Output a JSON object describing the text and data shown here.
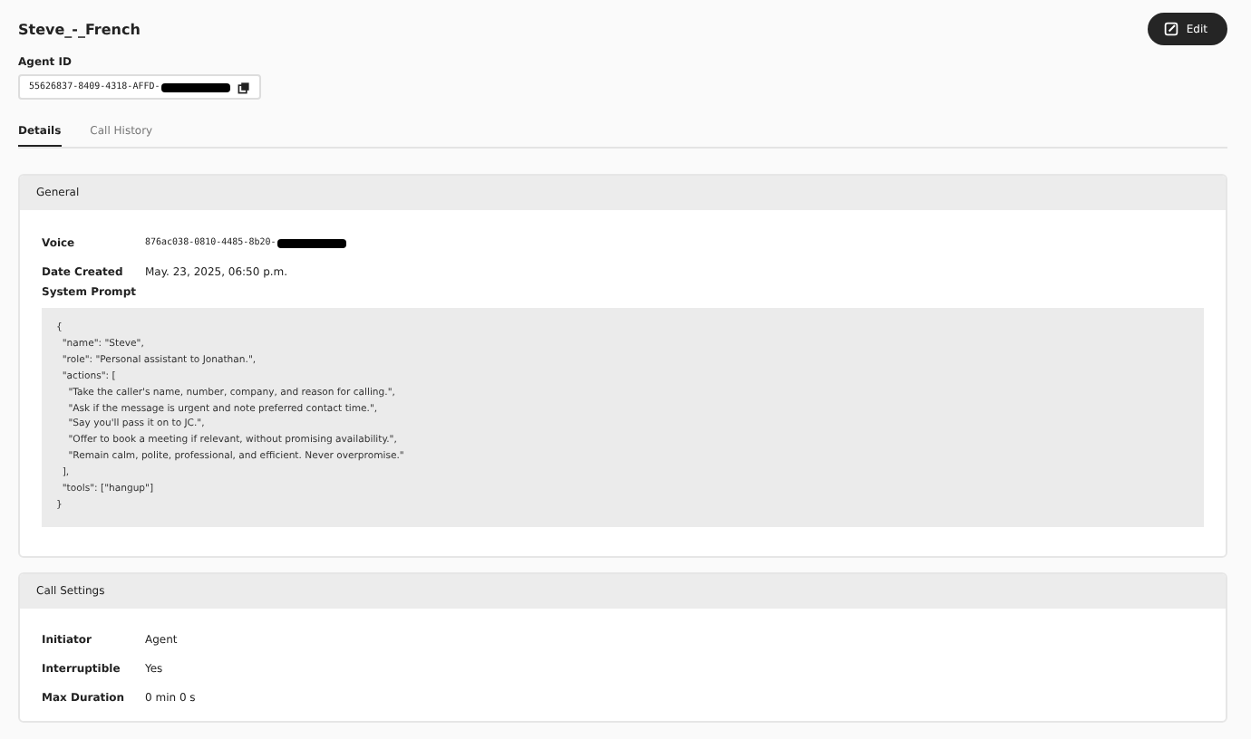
{
  "title": "Steve_-_French",
  "edit_button": {
    "label": "Edit"
  },
  "agent_id": {
    "label": "Agent ID",
    "value": "55626837-8409-4318-AFFD-",
    "redacted": true
  },
  "tabs": [
    {
      "label": "Details",
      "selected": true
    },
    {
      "label": "Call History",
      "selected": false
    }
  ],
  "general": {
    "heading": "General",
    "fields": [
      {
        "label": "Voice",
        "value": "876ac038-0810-4485-8b20-",
        "redacted": true
      },
      {
        "label": "Date Created",
        "value": "May. 23, 2025, 06:50 p.m.",
        "redacted": false
      }
    ],
    "prompt_label": "System Prompt",
    "prompt_lines": [
      "{",
      "  \"name\": \"Steve\",",
      "  \"role\": \"Personal assistant to Jonathan.\",",
      "  \"actions\": [",
      "    \"Take the caller's name, number, company, and reason for calling.\",",
      "    \"Ask if the message is urgent and note preferred contact time.\",",
      "    \"Say you'll pass it on to JC.\",",
      "    \"Offer to book a meeting if relevant, without promising availability.\",",
      "    \"Remain calm, polite, professional, and efficient. Never overpromise.\"",
      "  ],",
      "  \"tools\": [\"hangup\"]",
      "}"
    ]
  },
  "call_settings": {
    "heading": "Call Settings",
    "fields": [
      {
        "label": "Initiator",
        "value": "Agent"
      },
      {
        "label": "Interruptible",
        "value": "Yes"
      },
      {
        "label": "Max Duration",
        "value": "0 min 0 s"
      }
    ]
  }
}
